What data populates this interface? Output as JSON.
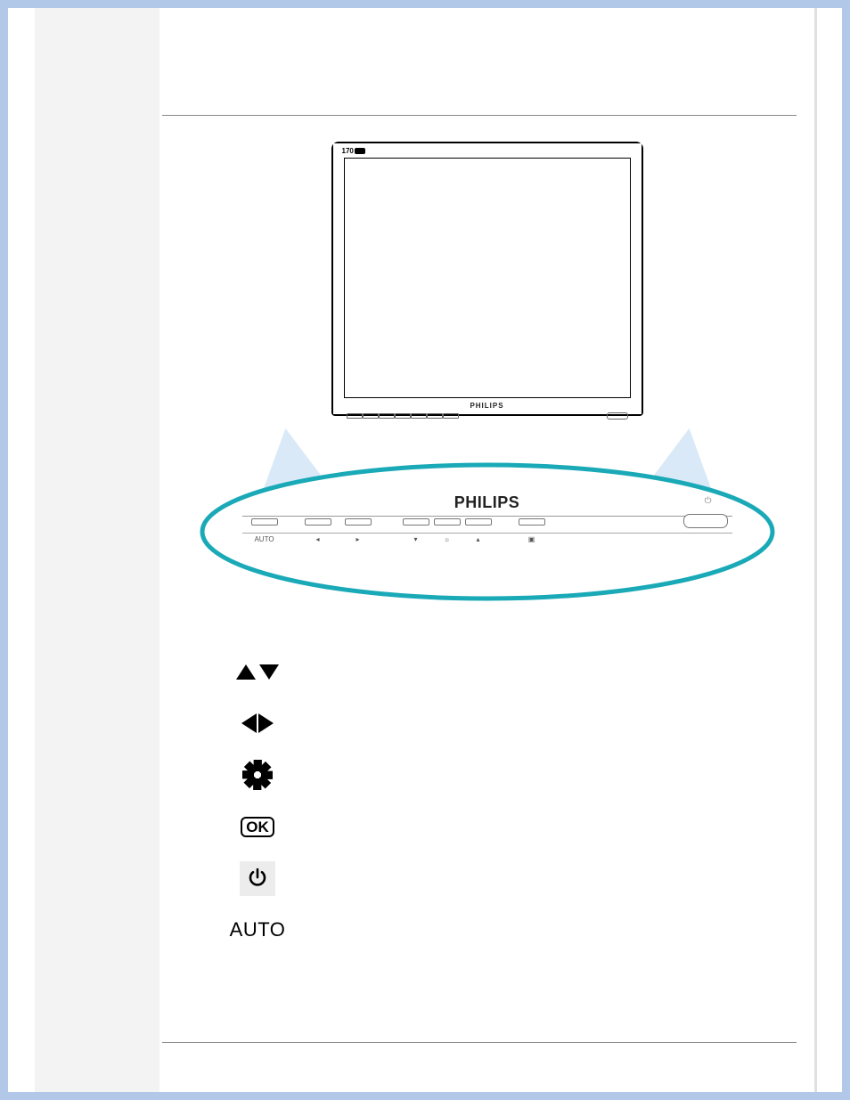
{
  "diagram": {
    "model_badge": "170",
    "brand_small": "PHILIPS",
    "brand_panel": "PHILIPS",
    "panel_labels": [
      "AUTO",
      "◂",
      "▸",
      "▾",
      "☼",
      "▴",
      "▣"
    ]
  },
  "icons": {
    "updown_name": "up-down-arrows-icon",
    "leftright_name": "left-right-arrows-icon",
    "brightness_name": "brightness-icon",
    "ok_label": "OK",
    "power_name": "power-icon",
    "auto_label": "AUTO"
  }
}
